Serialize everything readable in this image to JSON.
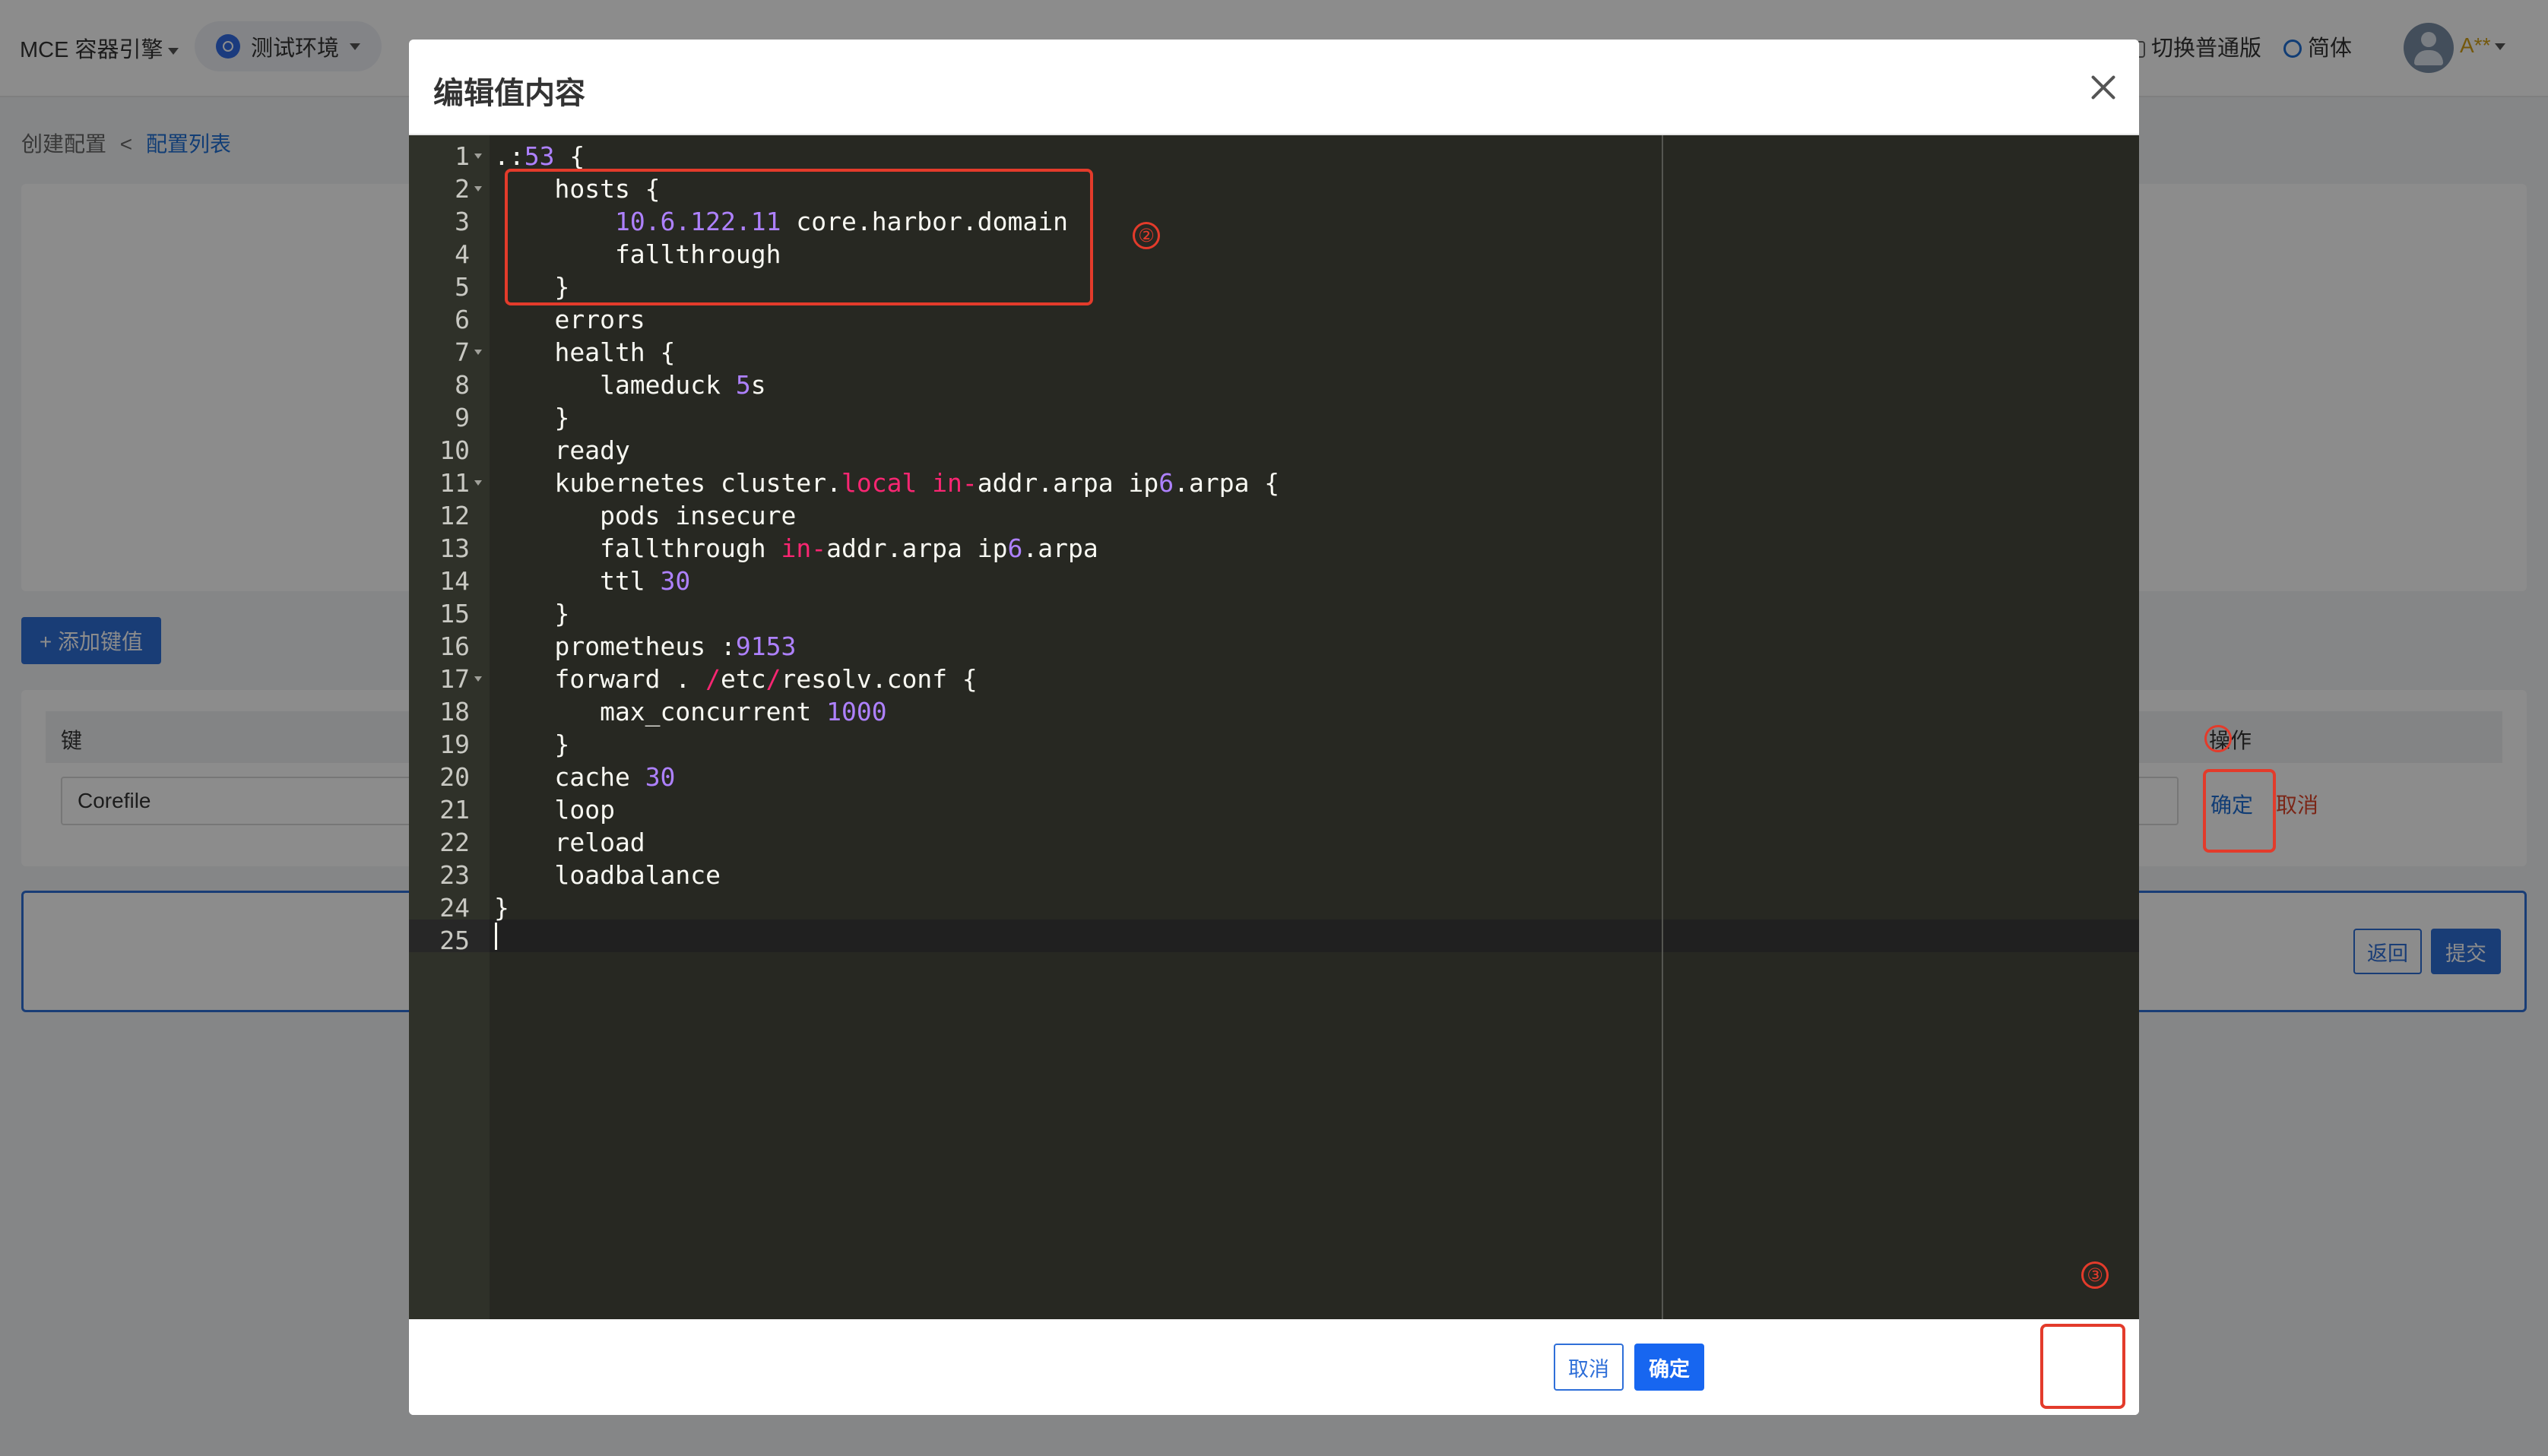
{
  "topbar": {
    "brand": "MCE 容器引擎",
    "environment": "测试环境",
    "switch_label": "切换普通版",
    "language": "简体",
    "user": "A**"
  },
  "breadcrumb": {
    "parent": "创建配置",
    "separator": "<",
    "current": "配置列表"
  },
  "page": {
    "add_button": "+ 添加键值",
    "table": {
      "col_key": "键",
      "col_op": "操作",
      "row_key_value": "Corefile",
      "op_confirm": "确定",
      "op_cancel": "取消"
    },
    "footer": {
      "back": "返回",
      "submit": "提交"
    }
  },
  "modal": {
    "title": "编辑值内容",
    "cancel": "取消",
    "confirm": "确定",
    "code_lines": [
      ".:53 {",
      "    hosts {",
      "        10.6.122.11 core.harbor.domain",
      "        fallthrough",
      "    }",
      "    errors",
      "    health {",
      "       lameduck 5s",
      "    }",
      "    ready",
      "    kubernetes cluster.local in-addr.arpa ip6.arpa {",
      "       pods insecure",
      "       fallthrough in-addr.arpa ip6.arpa",
      "       ttl 30",
      "    }",
      "    prometheus :9153",
      "    forward . /etc/resolv.conf {",
      "       max_concurrent 1000",
      "    }",
      "    cache 30",
      "    loop",
      "    reload",
      "    loadbalance",
      "}",
      ""
    ]
  },
  "annotations": {
    "marker_2": "②",
    "marker_3": "③"
  }
}
